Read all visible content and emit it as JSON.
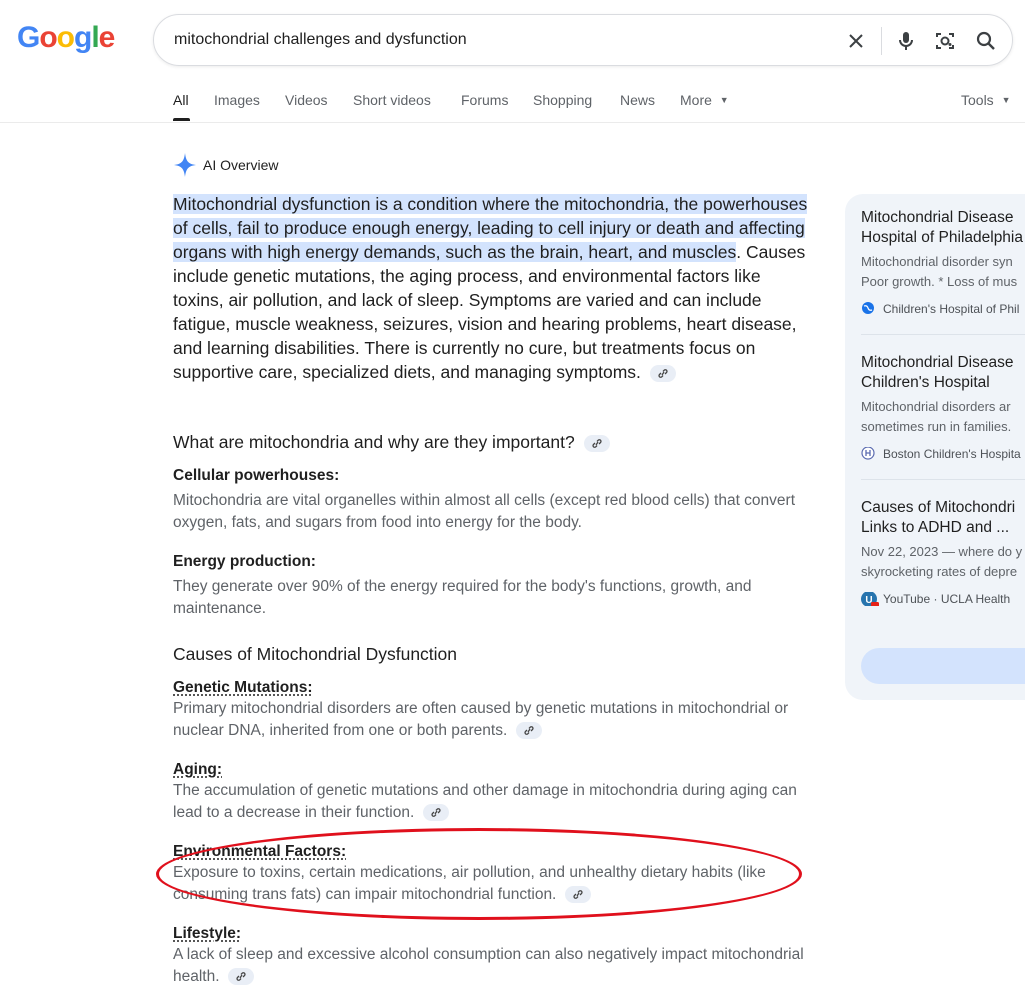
{
  "logo": {
    "letters": [
      "G",
      "o",
      "o",
      "g",
      "l",
      "e"
    ],
    "colors": [
      "#4285f4",
      "#ea4335",
      "#fbbc05",
      "#4285f4",
      "#34a853",
      "#ea4335"
    ]
  },
  "search": {
    "query": "mitochondrial challenges and dysfunction"
  },
  "tabs": [
    "All",
    "Images",
    "Videos",
    "Short videos",
    "Forums",
    "Shopping",
    "News",
    "More"
  ],
  "tools_label": "Tools",
  "ai_overview": {
    "label": "AI Overview",
    "intro_highlight": "Mitochondrial dysfunction is a condition where the mitochondria, the powerhouses of cells, fail to produce enough energy, leading to cell injury or death and affecting organs with high energy demands, such as the brain, heart, and muscles",
    "intro_rest": ". Causes include genetic mutations, the aging process, and environmental factors like toxins, air pollution, and lack of sleep. Symptoms are varied and can include fatigue, muscle weakness, seizures, vision and hearing problems, heart disease, and learning disabilities. There is currently no cure, but treatments focus on supportive care, specialized diets, and managing symptoms.",
    "section1_title": "What are mitochondria and why are they important?",
    "s1_items": [
      {
        "title": "Cellular powerhouses:",
        "text": "Mitochondria are vital organelles within almost all cells (except red blood cells) that convert oxygen, fats, and sugars from food into energy for the body."
      },
      {
        "title": "Energy production:",
        "text": "They generate over 90% of the energy required for the body's functions, growth, and maintenance."
      }
    ],
    "section2_title": "Causes of Mitochondrial Dysfunction",
    "s2_items": [
      {
        "title": "Genetic Mutations:",
        "text": "Primary mitochondrial disorders are often caused by genetic mutations in mitochondrial or nuclear DNA, inherited from one or both parents."
      },
      {
        "title": "Aging:",
        "text": "The accumulation of genetic mutations and other damage in mitochondria during aging can lead to a decrease in their function."
      },
      {
        "title": "Environmental Factors:",
        "text": "Exposure to toxins, certain medications, air pollution, and unhealthy dietary habits (like consuming trans fats) can impair mitochondrial function."
      },
      {
        "title": "Lifestyle:",
        "text": "A lack of sleep and excessive alcohol consumption can also negatively impact mitochondrial health."
      }
    ]
  },
  "sources": [
    {
      "title1": "Mitochondrial Disease",
      "title2": "Hospital of Philadelphia",
      "desc1": "Mitochondrial disorder syn",
      "desc2": "Poor growth. * Loss of mus",
      "site": "Children's Hospital of Phil"
    },
    {
      "title1": "Mitochondrial Disease",
      "title2": "Children's Hospital",
      "desc1": "Mitochondrial disorders ar",
      "desc2": "sometimes run in families.",
      "site": "Boston Children's Hospita"
    },
    {
      "title1": "Causes of Mitochondri",
      "title2": "Links to ADHD and ...",
      "desc1": "Nov 22, 2023 — where do y",
      "desc2": "skyrocketing rates of depre",
      "site": "YouTube · UCLA Health"
    }
  ]
}
